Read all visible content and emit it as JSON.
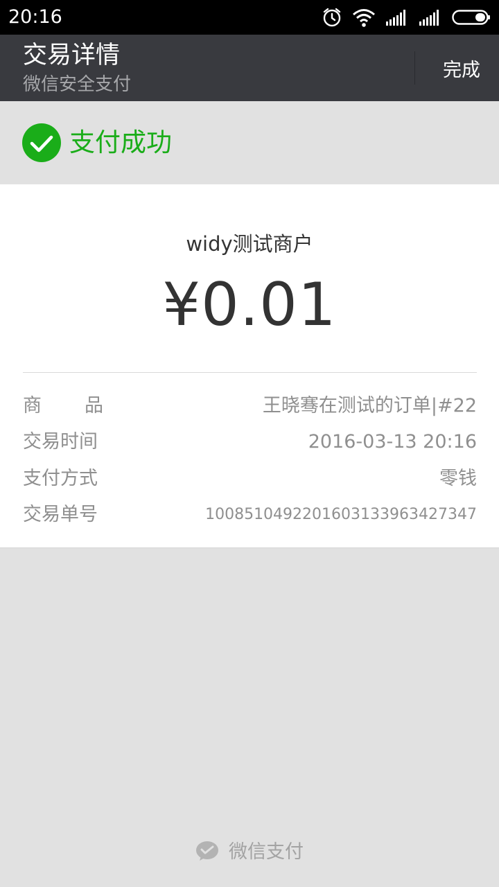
{
  "status_bar": {
    "time": "20:16",
    "icons": [
      "alarm-icon",
      "wifi-icon",
      "signal-icon",
      "signal-icon",
      "battery-icon"
    ]
  },
  "header": {
    "title": "交易详情",
    "subtitle": "微信安全支付",
    "done_label": "完成"
  },
  "result": {
    "status_text": "支付成功",
    "icon": "check-circle-icon",
    "accent_color": "#1aad19"
  },
  "payment": {
    "merchant": "widy测试商户",
    "amount": "¥0.01"
  },
  "details": [
    {
      "label": "商品",
      "value": "王晓骞在测试的订单|#22"
    },
    {
      "label": "交易时间",
      "value": "2016-03-13 20:16"
    },
    {
      "label": "支付方式",
      "value": "零钱"
    },
    {
      "label": "交易单号",
      "value": "1008510492201603133963427347"
    }
  ],
  "footer": {
    "icon": "wechat-pay-icon",
    "label": "微信支付"
  }
}
